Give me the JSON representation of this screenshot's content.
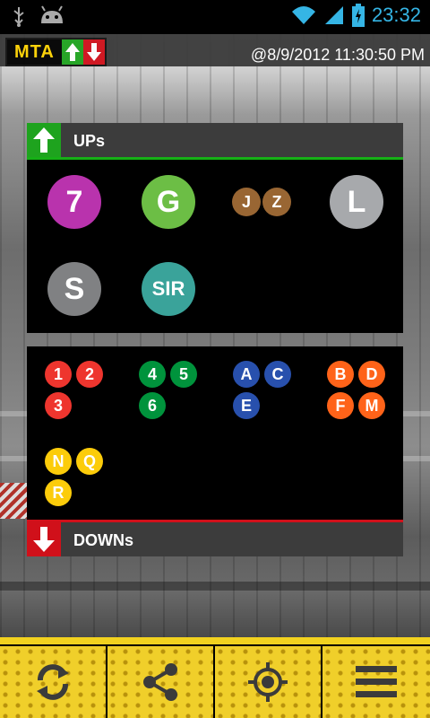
{
  "status_bar": {
    "time": "23:32",
    "icons": [
      "usb-icon",
      "android-debug-icon",
      "wifi-icon",
      "signal-icon",
      "battery-charging-icon"
    ]
  },
  "header": {
    "logo_text": "MTA",
    "timestamp": "@8/9/2012 11:30:50 PM"
  },
  "ups": {
    "label": "UPs",
    "lines": [
      {
        "id": "7",
        "color": "#b933ad"
      },
      {
        "id": "G",
        "color": "#6cbe45"
      },
      {
        "id": "J",
        "color": "#996633"
      },
      {
        "id": "Z",
        "color": "#996633"
      },
      {
        "id": "L",
        "color": "#a7a9ac"
      },
      {
        "id": "S",
        "color": "#808183"
      },
      {
        "id": "SIR",
        "color": "#3aa39a"
      }
    ]
  },
  "downs": {
    "label": "DOWNs",
    "lines": [
      {
        "id": "1",
        "color": "#ee352e"
      },
      {
        "id": "2",
        "color": "#ee352e"
      },
      {
        "id": "3",
        "color": "#ee352e"
      },
      {
        "id": "4",
        "color": "#00933c"
      },
      {
        "id": "5",
        "color": "#00933c"
      },
      {
        "id": "6",
        "color": "#00933c"
      },
      {
        "id": "A",
        "color": "#2850ad"
      },
      {
        "id": "C",
        "color": "#2850ad"
      },
      {
        "id": "E",
        "color": "#2850ad"
      },
      {
        "id": "B",
        "color": "#ff6319"
      },
      {
        "id": "D",
        "color": "#ff6319"
      },
      {
        "id": "F",
        "color": "#ff6319"
      },
      {
        "id": "M",
        "color": "#ff6319"
      },
      {
        "id": "N",
        "color": "#fccc0a"
      },
      {
        "id": "Q",
        "color": "#fccc0a"
      },
      {
        "id": "R",
        "color": "#fccc0a"
      }
    ]
  },
  "toolbar": {
    "buttons": [
      "refresh-icon",
      "share-icon",
      "locate-icon",
      "menu-icon"
    ]
  },
  "colors": {
    "up_accent": "#1ea31e",
    "down_accent": "#d0101a",
    "toolbar_yellow": "#f0cf2a",
    "clock_blue": "#35b5e5"
  }
}
